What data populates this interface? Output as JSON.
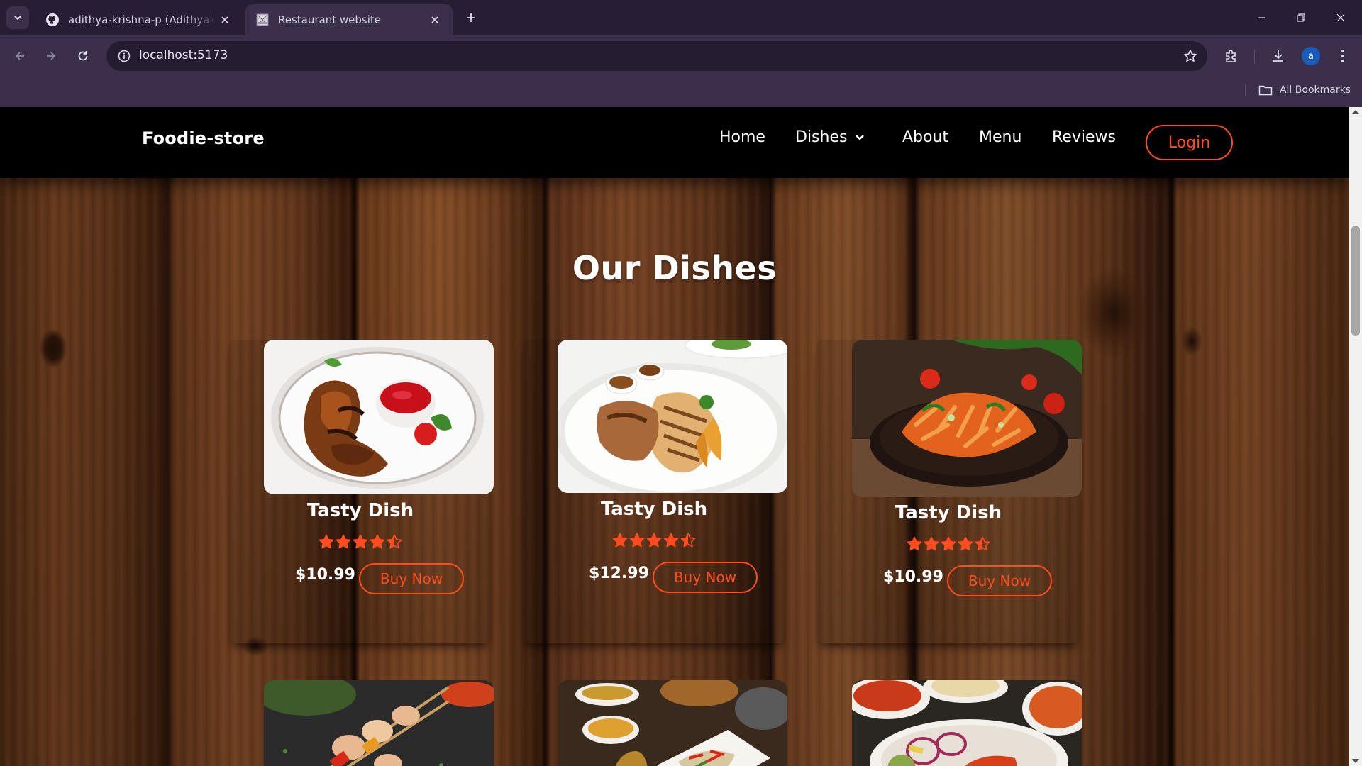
{
  "browser": {
    "tabs": [
      {
        "title": "adithya-krishna-p (Adithyakrishna)",
        "favicon": "github-icon",
        "active": false
      },
      {
        "title": "Restaurant website",
        "favicon": "page-icon",
        "active": true
      }
    ],
    "url": "localhost:5173",
    "profile_initial": "a",
    "bookmarks_label": "All Bookmarks"
  },
  "site": {
    "brand": "Foodie-store",
    "nav": {
      "home": "Home",
      "dishes": "Dishes",
      "about": "About",
      "menu": "Menu",
      "reviews": "Reviews",
      "login": "Login"
    },
    "section_title": "Our Dishes",
    "dishes": [
      {
        "name": "Tasty Dish",
        "price": "$10.99",
        "rating": 4.5,
        "button": "Buy Now",
        "image": "grilled-chicken-wings"
      },
      {
        "name": "Tasty Dish",
        "price": "$12.99",
        "rating": 4.5,
        "button": "Buy Now",
        "image": "grilled-chicken-breast-plate"
      },
      {
        "name": "Tasty Dish",
        "price": "$10.99",
        "rating": 4.5,
        "button": "Buy Now",
        "image": "penne-pasta-tomato"
      }
    ],
    "more_dishes_images": [
      "chicken-skewers",
      "indian-spread",
      "curry-platter"
    ]
  },
  "colors": {
    "accent": "#ff4d1f",
    "navbar": "#000000",
    "browser_frame": "#3b2f4c"
  }
}
